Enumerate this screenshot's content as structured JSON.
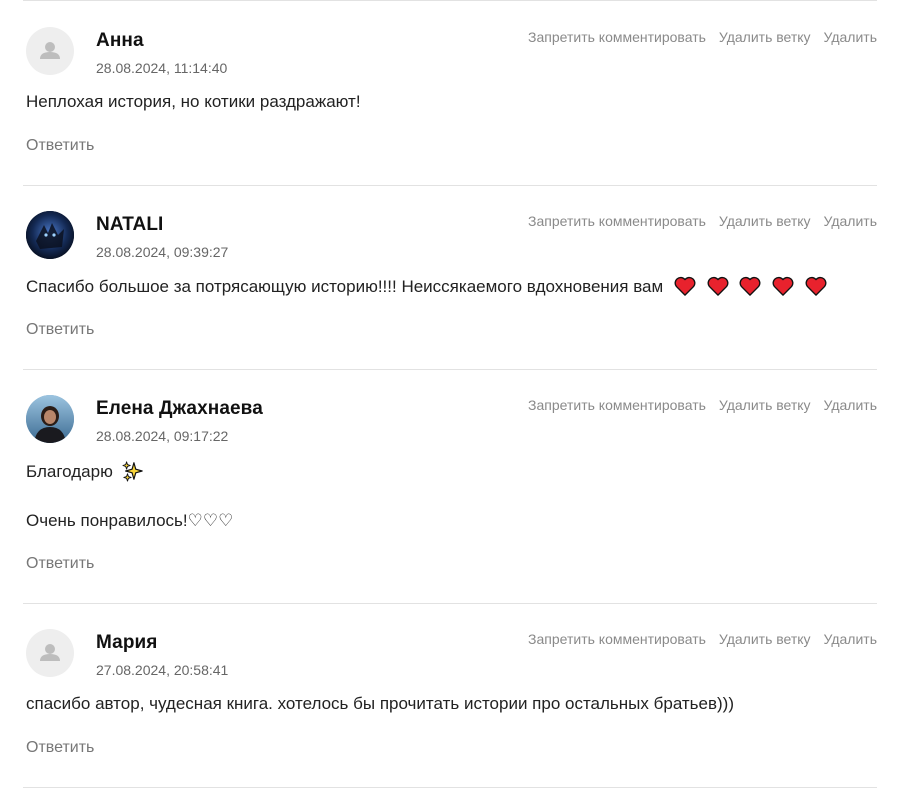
{
  "actions": {
    "ban_label": "Запретить комментировать",
    "delete_thread_label": "Удалить ветку",
    "delete_label": "Удалить"
  },
  "reply_label": "Ответить",
  "comments": [
    {
      "author": "Анна",
      "date": "28.08.2024, 11:14:40",
      "text": "Неплохая история, но котики раздражают!"
    },
    {
      "author": "NATALI",
      "date": "28.08.2024, 09:39:27",
      "text": "Спасибо большое за потрясающую историю!!!! Неиссякаемого вдохновения вам"
    },
    {
      "author": "Елена Джахнаева",
      "date": "28.08.2024, 09:17:22",
      "text": "Благодарю",
      "text2": "Очень понравилось!♡♡♡"
    },
    {
      "author": "Мария",
      "date": "27.08.2024, 20:58:41",
      "text": "спасибо автор, чудесная книга. хотелось бы прочитать истории про остальных братьев)))"
    }
  ]
}
